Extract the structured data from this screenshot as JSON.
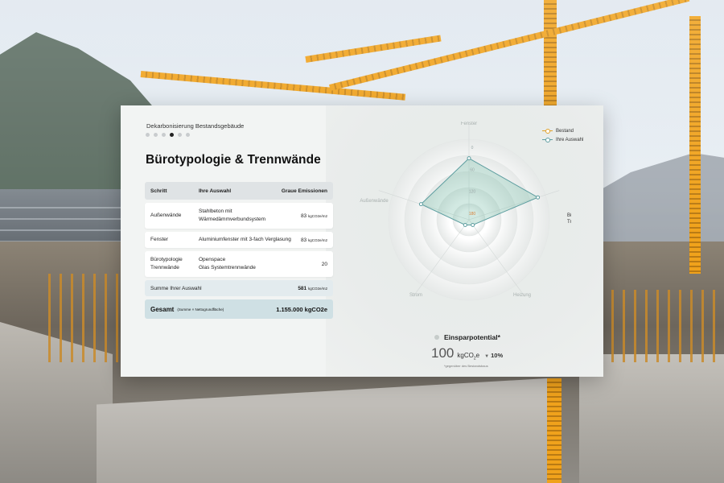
{
  "breadcrumb": "Dekarbonisierung Bestandsgebäude",
  "pager": {
    "total": 5,
    "active_index": 3
  },
  "title": "Bürotypologie & Trennwände",
  "table": {
    "headers": [
      "Schritt",
      "Ihre Auswahl",
      "Graue Emissionen"
    ],
    "rows": [
      {
        "step": "Außenwände",
        "choice_line1": "Stahlbeton mit",
        "choice_line2": "Wärmedämmverbundsystem",
        "value": "83",
        "unit": "kgCO2e/m2"
      },
      {
        "step": "Fenster",
        "choice_line1": "Aluminiumfenster mit 3-fach Verglasung",
        "choice_line2": "",
        "value": "83",
        "unit": "kgCO2e/m2"
      },
      {
        "step_line1": "Bürotypologie",
        "step_line2": "Trennwände",
        "choice_line1": "Openspace",
        "choice_line2": "Glas Systemtrennwände",
        "value": "20",
        "unit": ""
      }
    ],
    "sum": {
      "label": "Summe Ihrer Auswahl",
      "value": "581",
      "unit": "kgCO2e/m2"
    },
    "total": {
      "label": "Gesamt",
      "sub": "(Summe × Nettogrundfläche)",
      "value": "1.155.000 kgCO2e"
    }
  },
  "legend": [
    {
      "label": "Bestand",
      "color": "#e0a12a"
    },
    {
      "label": "Ihre Auswahl",
      "color": "#5e9ea0"
    }
  ],
  "chart_data": {
    "type": "radar",
    "axes": [
      "Fenster",
      "Bürotypologie & Trennwände",
      "Heizung",
      "Strom",
      "Außenwände"
    ],
    "axis_label_lines": {
      "Bürotypologie & Trennwände": [
        "Bürotypologie &",
        "Trennwände"
      ]
    },
    "ticks": [
      "0",
      "60",
      "120",
      "180"
    ],
    "tick_colors": [
      "#9aa9a8",
      "#9aa9a8",
      "#9aa9a8",
      "#d9823b"
    ],
    "max": 180,
    "reversed": true,
    "series": [
      {
        "name": "Ihre Auswahl",
        "values": [
          30,
          0,
          180,
          180,
          60
        ],
        "color": "#5e9ea0"
      }
    ]
  },
  "savings": {
    "heading": "Einsparpotential*",
    "value": "100",
    "unit_prefix": "kgCO",
    "unit_sub": "2",
    "unit_suffix": "e",
    "arrow": "▼",
    "percent": "10%",
    "note": "*gegenüber des Bestandsbaus"
  }
}
